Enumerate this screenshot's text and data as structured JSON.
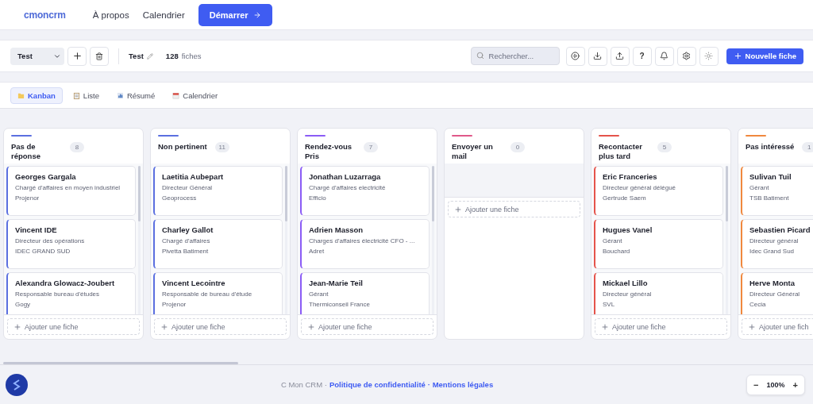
{
  "nav": {
    "logo": "cmoncrm",
    "links": [
      "À propos",
      "Calendrier"
    ],
    "cta": "Démarrer"
  },
  "toolbar": {
    "select_value": "Test",
    "title": "Test",
    "count": "128",
    "count_label": "fiches",
    "search_placeholder": "Rechercher...",
    "help": "?",
    "new_button": "Nouvelle fiche"
  },
  "views": [
    {
      "kind": "kanban",
      "label": "Kanban",
      "selected": true
    },
    {
      "kind": "list",
      "label": "Liste",
      "selected": false
    },
    {
      "kind": "summary",
      "label": "Résumé",
      "selected": false
    },
    {
      "kind": "calendar",
      "label": "Calendrier",
      "selected": false
    }
  ],
  "columns": [
    {
      "title": "Pas de réponse",
      "count": "8",
      "color": "#5b6fe0",
      "add_label": "Ajouter une fiche",
      "cards": [
        {
          "name": "Georges Gargala",
          "role": "Chargé d'affaires en moyen industriel",
          "company": "Projenor"
        },
        {
          "name": "Vincent IDE",
          "role": "Directeur des opérations",
          "company": "IDEC GRAND SUD"
        },
        {
          "name": "Alexandra Glowacz-Joubert",
          "role": "Responsable bureau d'études",
          "company": "Gogy"
        }
      ]
    },
    {
      "title": "Non pertinent",
      "count": "11",
      "color": "#5b6fe0",
      "add_label": "Ajouter une fiche",
      "cards": [
        {
          "name": "Laetitia Aubepart",
          "role": "Directeur Général",
          "company": "Geoprocess"
        },
        {
          "name": "Charley Gallot",
          "role": "Chargé d'affaires",
          "company": "Pivetta Batiment"
        },
        {
          "name": "Vincent Lecointre",
          "role": "Responsable de bureau d'étude",
          "company": "Projenor"
        }
      ]
    },
    {
      "title": "Rendez-vous Pris",
      "count": "7",
      "color": "#8b5cf6",
      "add_label": "Ajouter une fiche",
      "cards": [
        {
          "name": "Jonathan Luzarraga",
          "role": "Chargé d'affaires electricité",
          "company": "Efficio"
        },
        {
          "name": "Adrien Masson",
          "role": "Charges d'affaires électricité CFO - ...",
          "company": "Adret"
        },
        {
          "name": "Jean-Marie Teil",
          "role": "Gérant",
          "company": "Thermiconseil France"
        }
      ]
    },
    {
      "title": "Envoyer un mail",
      "count": "0",
      "color": "#e0598a",
      "add_label": "Ajouter une fiche"
    },
    {
      "title": "Recontacter plus tard",
      "count": "5",
      "color": "#e5534b",
      "add_label": "Ajouter une fiche",
      "cards": [
        {
          "name": "Eric Franceries",
          "role": "Directeur général délégué",
          "company": "Gertrude Saem"
        },
        {
          "name": "Hugues Vanel",
          "role": "Gérant",
          "company": "Bouchard"
        },
        {
          "name": "Mickael Lillo",
          "role": "Directeur général",
          "company": "SVL"
        }
      ]
    },
    {
      "title": "Pas intéressé",
      "count": "1",
      "color": "#f0883e",
      "add_label": "Ajouter une fich",
      "cards": [
        {
          "name": "Sulivan Tuil",
          "role": "Gérant",
          "company": "TSB Batiment"
        },
        {
          "name": "Sebastien Picard",
          "role": "Directeur général",
          "company": "Idec Grand Sud"
        },
        {
          "name": "Herve Monta",
          "role": "Directeur Général",
          "company": "Cecia"
        }
      ]
    }
  ],
  "footer": {
    "brand": "C Mon CRM ·",
    "links": [
      "Politique de confidentialité",
      "· Mentions légales"
    ]
  },
  "zoom": {
    "minus": "−",
    "value": "100%",
    "plus": "+"
  }
}
